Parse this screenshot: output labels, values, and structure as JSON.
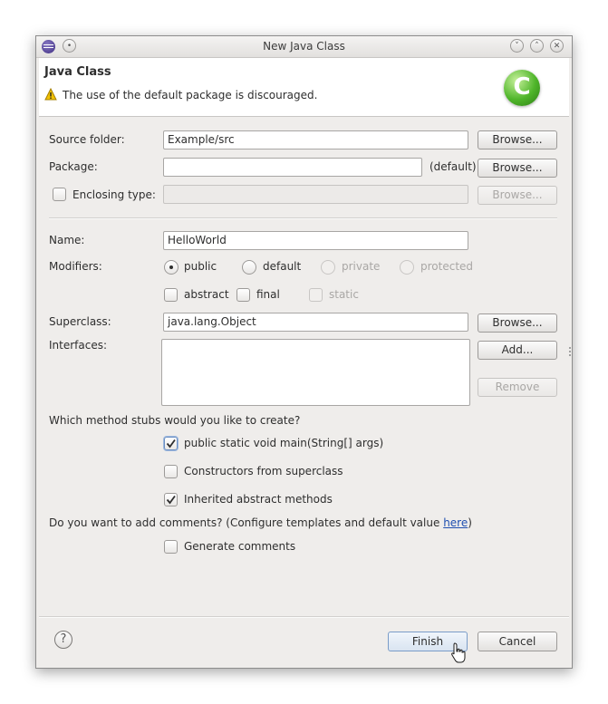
{
  "window": {
    "title": "New Java Class"
  },
  "banner": {
    "heading": "Java Class",
    "message": "The use of the default package is discouraged."
  },
  "form": {
    "source_folder": {
      "label": "Source folder:",
      "value": "Example/src",
      "browse": "Browse..."
    },
    "package": {
      "label": "Package:",
      "value": "",
      "default_hint": "(default)",
      "browse": "Browse..."
    },
    "enclosing_type": {
      "label": "Enclosing type:",
      "checked": false,
      "value": "",
      "browse": "Browse..."
    },
    "name": {
      "label": "Name:",
      "value": "HelloWorld"
    },
    "modifiers": {
      "label": "Modifiers:",
      "access": [
        "public",
        "default",
        "private",
        "protected"
      ],
      "selected": "public",
      "flags": [
        "abstract",
        "final",
        "static"
      ]
    },
    "superclass": {
      "label": "Superclass:",
      "value": "java.lang.Object",
      "browse": "Browse..."
    },
    "interfaces": {
      "label": "Interfaces:",
      "add": "Add...",
      "remove": "Remove"
    }
  },
  "stubs": {
    "question": "Which method stubs would you like to create?",
    "options": [
      {
        "label": "public static void main(String[] args)",
        "checked": true
      },
      {
        "label": "Constructors from superclass",
        "checked": false
      },
      {
        "label": "Inherited abstract methods",
        "checked": true
      }
    ]
  },
  "comments": {
    "question_prefix": "Do you want to add comments? (Configure templates and default value ",
    "link": "here",
    "question_suffix": ")",
    "generate_label": "Generate comments",
    "checked": false
  },
  "footer": {
    "finish": "Finish",
    "cancel": "Cancel"
  },
  "colors": {
    "link": "#1f4fb0",
    "warning": "#e8b400",
    "logo": "#3faa2a"
  }
}
